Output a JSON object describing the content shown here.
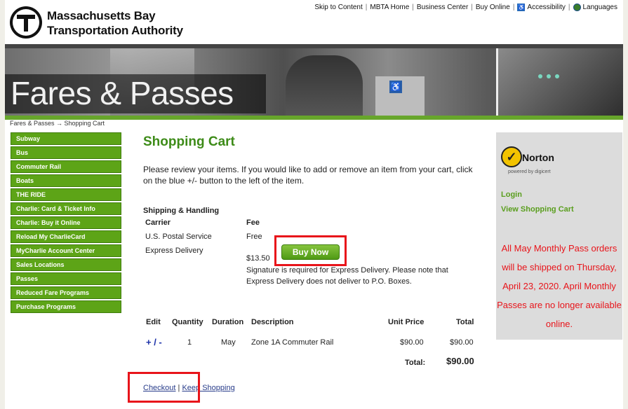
{
  "header": {
    "org_line1": "Massachusetts Bay",
    "org_line2": "Transportation Authority",
    "top_links": [
      "Skip to Content",
      "MBTA Home",
      "Business Center",
      "Buy Online",
      "Accessibility",
      "Languages"
    ]
  },
  "banner": {
    "title": "Fares & Passes"
  },
  "breadcrumb": "Fares & Passes → Shopping Cart",
  "nav": {
    "items": [
      "Subway",
      "Bus",
      "Commuter Rail",
      "Boats",
      "THE RIDE",
      "Charlie: Card & Ticket Info",
      "Charlie: Buy it Online",
      "Reload My CharlieCard",
      "MyCharlie Account Center",
      "Sales Locations",
      "Passes",
      "Reduced Fare Programs",
      "Purchase Programs"
    ]
  },
  "main": {
    "title": "Shopping Cart",
    "intro": "Please review your items. If you would like to add or remove an item from your cart, click on the blue +/- button to the left of the item.",
    "shipping": {
      "heading": "Shipping & Handling",
      "col_carrier": "Carrier",
      "col_fee": "Fee",
      "usps": "U.S. Postal Service",
      "usps_fee": "Free",
      "express": "Express Delivery",
      "express_fee": "$13.50",
      "express_note": "Signature is required for Express Delivery. Please note that Express Delivery does not deliver to P.O. Boxes.",
      "buy_now": "Buy Now"
    },
    "cart": {
      "headers": [
        "Edit",
        "Quantity",
        "Duration",
        "Description",
        "Unit Price",
        "Total"
      ],
      "row": {
        "edit": "+ / -",
        "quantity": "1",
        "duration": "May",
        "description": "Zone 1A Commuter Rail",
        "unit_price": "$90.00",
        "total": "$90.00"
      },
      "total_label": "Total:",
      "total_value": "$90.00"
    },
    "checkout": "Checkout",
    "separator": " | ",
    "keep_shopping": "Keep Shopping"
  },
  "sidebar_right": {
    "norton_brand": "Norton",
    "norton_sub": "powered by digicert",
    "login": "Login",
    "view_cart": "View Shopping Cart",
    "notice": "All May Monthly Pass orders will be shipped on Thursday, April 23, 2020. April Monthly Passes are no longer available online."
  },
  "colors": {
    "accent_green": "#5da417",
    "title_green": "#3d8b18",
    "alert_red": "#e8141a",
    "link_blue": "#1a2fa8"
  }
}
